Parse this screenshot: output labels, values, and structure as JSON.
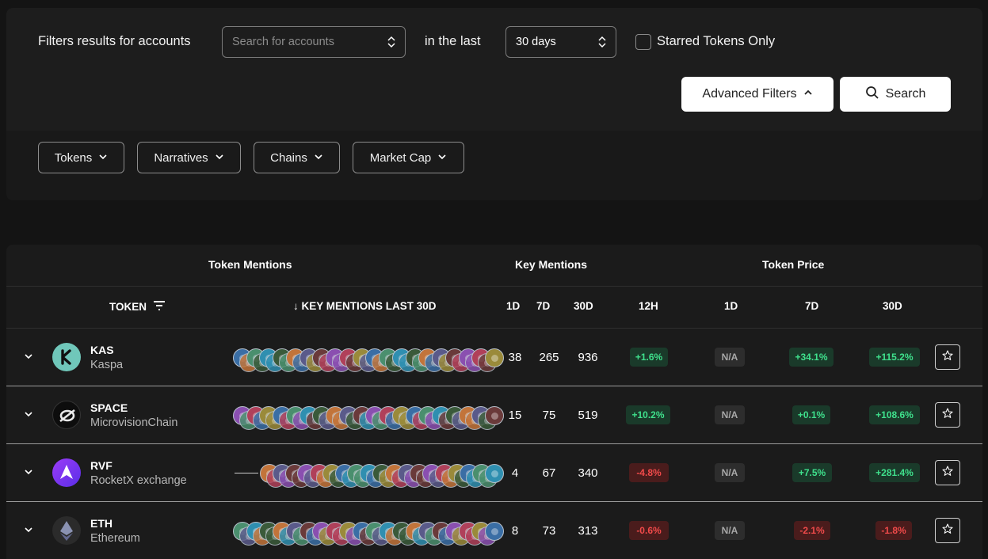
{
  "filters": {
    "intro_label": "Filters results for accounts",
    "accounts_placeholder": "Search for accounts",
    "in_the_last_label": "in the last",
    "period_value": "30 days",
    "starred_label": "Starred Tokens Only",
    "starred_checked": false,
    "advanced_filters_label": "Advanced Filters",
    "search_label": "Search",
    "chips": [
      {
        "label": "Tokens"
      },
      {
        "label": "Narratives"
      },
      {
        "label": "Chains"
      },
      {
        "label": "Market Cap"
      }
    ]
  },
  "table": {
    "group_headers": {
      "token_mentions": "Token Mentions",
      "key_mentions": "Key Mentions",
      "token_price": "Token Price"
    },
    "columns": {
      "token": "TOKEN",
      "key_mentions_last": "↓ KEY MENTIONS LAST 30D",
      "km_1d": "1D",
      "km_7d": "7D",
      "km_30d": "30D",
      "p_12h": "12H",
      "p_1d": "1D",
      "p_7d": "7D",
      "p_30d": "30D"
    },
    "rows": [
      {
        "symbol": "KAS",
        "name": "Kaspa",
        "km_1d": "38",
        "km_7d": "265",
        "km_30d": "936",
        "p_12h": "+1.6%",
        "p_1d": "N/A",
        "p_7d": "+34.1%",
        "p_30d": "+115.2%",
        "logo_icon": "kaspa-logo",
        "logo_color": "#70c7ba"
      },
      {
        "symbol": "SPACE",
        "name": "MicrovisionChain",
        "km_1d": "15",
        "km_7d": "75",
        "km_30d": "519",
        "p_12h": "+10.2%",
        "p_1d": "N/A",
        "p_7d": "+0.1%",
        "p_30d": "+108.6%",
        "logo_icon": "microvision-logo",
        "logo_color": "#111111"
      },
      {
        "symbol": "RVF",
        "name": "RocketX exchange",
        "km_1d": "4",
        "km_7d": "67",
        "km_30d": "340",
        "p_12h": "-4.8%",
        "p_1d": "N/A",
        "p_7d": "+7.5%",
        "p_30d": "+281.4%",
        "logo_icon": "rocketx-logo",
        "logo_color": "#7b3cf0"
      },
      {
        "symbol": "ETH",
        "name": "Ethereum",
        "km_1d": "8",
        "km_7d": "73",
        "km_30d": "313",
        "p_12h": "-0.6%",
        "p_1d": "N/A",
        "p_7d": "-2.1%",
        "p_30d": "-1.8%",
        "logo_icon": "ethereum-logo",
        "logo_color": "#2b2b2b"
      }
    ]
  },
  "colors": {
    "background": "#141414",
    "panel": "#1d1d1d",
    "positive": "#3fe08c",
    "negative": "#f04a4a",
    "neutral": "#a8a8a8"
  }
}
